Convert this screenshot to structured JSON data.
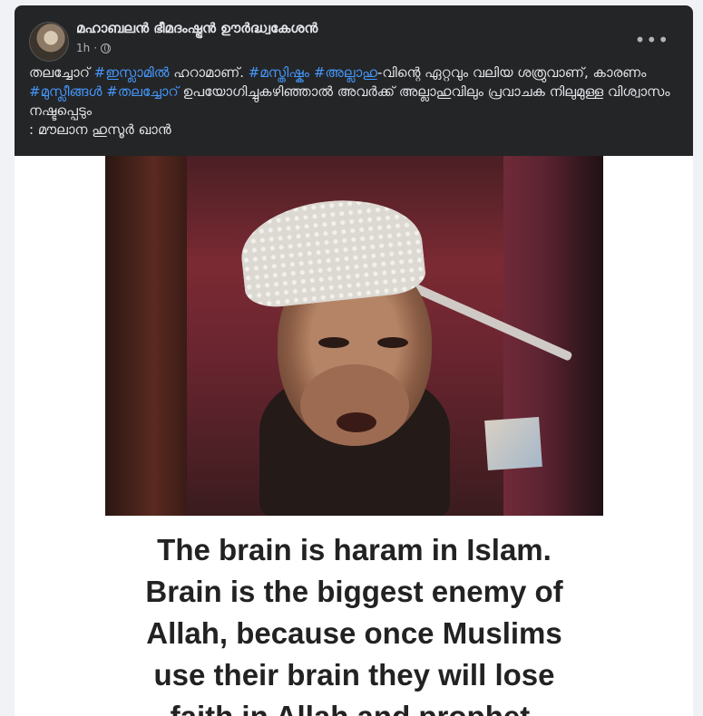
{
  "post": {
    "author": "മഹാബലൻ ഭീമദംഷ്ട്രൻ ഊർദ്ധ്വകേശൻ",
    "time": "1h",
    "audience_icon": "globe-icon",
    "more_icon": "more-options-icon",
    "more_label": "•••",
    "caption": {
      "p1": "തലച്ചോറ് ",
      "tag1": "#ഇസ്ലാമിൽ",
      "p2": " ഹറാമാണ്. ",
      "tag2": "#മസ്തിഷ്കം",
      "p3": " ",
      "tag3": "#അല്ലാഹു",
      "p4": "-വിന്റെ ഏറ്റവും വലിയ ശത്രുവാണ്, കാരണം ",
      "tag4": "#മുസ്ലീങ്ങൾ",
      "p5": " ",
      "tag5": "#തലച്ചോറ്",
      "p6": " ഉപയോഗിച്ചുകഴിഞ്ഞാൽ അവർക്ക് അല്ലാഹുവിലും പ്രവാചക നിലുമുള്ള വിശ്വാസം നഷ്ടപ്പെടും",
      "line2": ": മൗലാന ഹുസൂർ ഖാൻ"
    },
    "image_text": {
      "line1": "The brain is haram in Islam.",
      "line2": "Brain is the biggest enemy of",
      "line3": "Allah, because once Muslims",
      "line4": "use their brain they will lose",
      "line5": "faith in Allah and prophet."
    },
    "colors": {
      "card_bg": "#242526",
      "text": "#e4e6eb",
      "secondary": "#b0b3b8",
      "hashtag": "#4599ff"
    }
  }
}
